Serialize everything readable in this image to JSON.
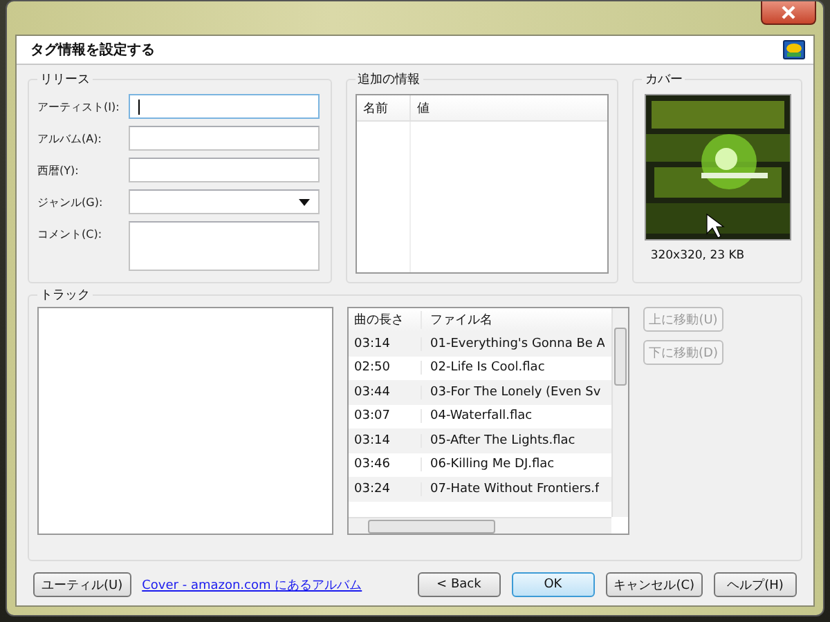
{
  "window": {
    "title": "タグ情報を設定する"
  },
  "release": {
    "title": "リリース",
    "fields": [
      {
        "label": "アーティスト(I):",
        "kind": "text",
        "focused": true
      },
      {
        "label": "アルバム(A):",
        "kind": "text",
        "focused": false
      },
      {
        "label": "西暦(Y):",
        "kind": "text",
        "focused": false
      },
      {
        "label": "ジャンル(G):",
        "kind": "combo",
        "focused": false
      },
      {
        "label": "コメント(C):",
        "kind": "multiline",
        "focused": false
      }
    ]
  },
  "extra_info": {
    "title": "追加の情報",
    "columns": [
      "名前",
      "値"
    ]
  },
  "cover": {
    "title": "カバー",
    "info": "320x320, 23 KB"
  },
  "tracks": {
    "title": "トラック",
    "columns": [
      "曲の長さ",
      "ファイル名"
    ],
    "rows": [
      {
        "length": "03:14",
        "file": "01-Everything's Gonna Be A"
      },
      {
        "length": "02:50",
        "file": "02-Life Is Cool.flac"
      },
      {
        "length": "03:44",
        "file": "03-For The Lonely (Even Sv"
      },
      {
        "length": "03:07",
        "file": "04-Waterfall.flac"
      },
      {
        "length": "03:14",
        "file": "05-After The Lights.flac"
      },
      {
        "length": "03:46",
        "file": "06-Killing Me DJ.flac"
      },
      {
        "length": "03:24",
        "file": "07-Hate Without Frontiers.f"
      }
    ],
    "buttons": [
      {
        "label": "上に移動(U)",
        "disabled": true
      },
      {
        "label": "下に移動(D)",
        "disabled": true
      }
    ]
  },
  "footer": {
    "utility": "ユーティル(U)",
    "link": "Cover - amazon.com にあるアルバム",
    "buttons": [
      {
        "label": "< Back",
        "default": false
      },
      {
        "label": "OK",
        "default": true
      },
      {
        "label": "キャンセル(C)",
        "default": false
      },
      {
        "label": "ヘルプ(H)",
        "default": false
      }
    ]
  }
}
